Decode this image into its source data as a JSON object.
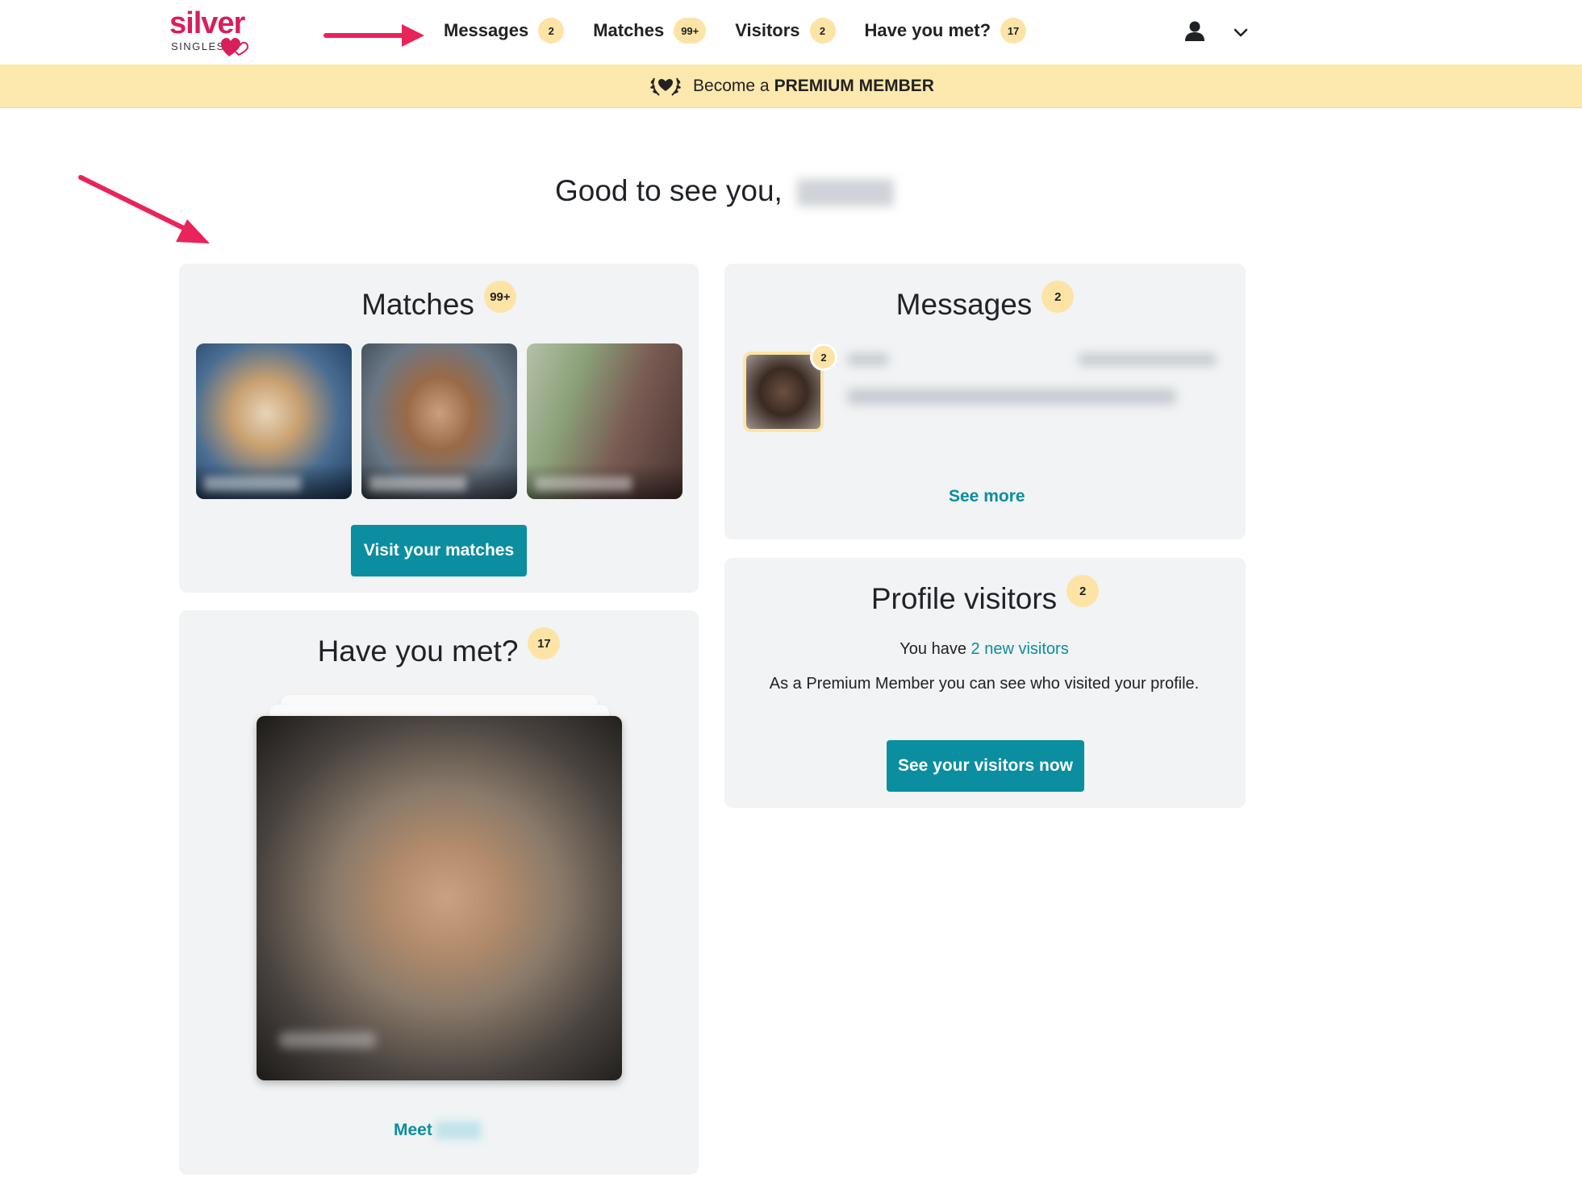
{
  "brand": {
    "name_top": "silver",
    "name_bottom": "SINGLES",
    "color": "#d81e5b"
  },
  "nav": {
    "items": [
      {
        "label": "Messages",
        "badge": "2"
      },
      {
        "label": "Matches",
        "badge": "99+"
      },
      {
        "label": "Visitors",
        "badge": "2"
      },
      {
        "label": "Have you met?",
        "badge": "17"
      }
    ],
    "user_icon": "user-icon",
    "menu_icon": "chevron-down-icon"
  },
  "premium_banner": {
    "prefix": "Become a",
    "emphasis": "PREMIUM MEMBER",
    "icon": "laurel-heart-icon"
  },
  "greeting": {
    "text": "Good to see you,"
  },
  "matches_card": {
    "title": "Matches",
    "badge": "99+",
    "button": "Visit your matches"
  },
  "messages_card": {
    "title": "Messages",
    "badge": "2",
    "avatar_badge": "2",
    "see_more": "See more"
  },
  "visitors_card": {
    "title": "Profile visitors",
    "badge": "2",
    "line1_prefix": "You have",
    "line1_link": "2 new visitors",
    "line2": "As a Premium Member you can see who visited your profile.",
    "button": "See your visitors now"
  },
  "have_you_met_card": {
    "title": "Have you met?",
    "badge": "17",
    "meet_label": "Meet"
  },
  "colors": {
    "accent": "#0a8ea0",
    "badge": "#fde4a6",
    "banner": "#fde8ad",
    "card": "#f1f3f4",
    "arrow": "#e8245a"
  }
}
